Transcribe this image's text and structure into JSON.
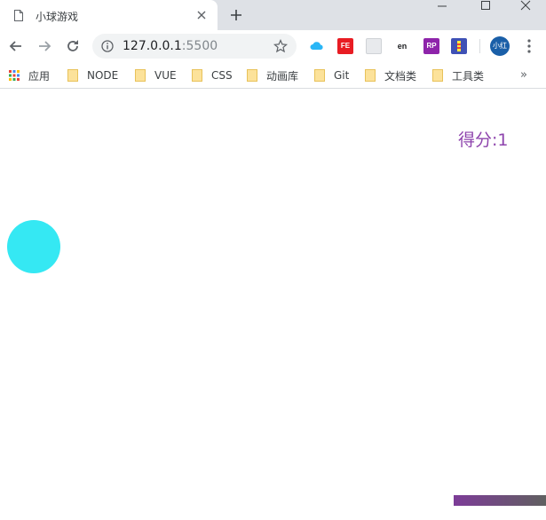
{
  "browser": {
    "tab": {
      "title": "小球游戏"
    },
    "toolbar": {
      "url_host": "127.0.0.1",
      "url_port": ":5500",
      "extensions": {
        "fe": "FE",
        "en": "en",
        "rp": "RP"
      },
      "profile": "小红"
    },
    "bookmarks": [
      {
        "label": "应用",
        "icon": "apps-grid-icon"
      },
      {
        "label": "NODE",
        "icon": "folder-icon"
      },
      {
        "label": "VUE",
        "icon": "folder-icon"
      },
      {
        "label": "CSS",
        "icon": "folder-icon"
      },
      {
        "label": "动画库",
        "icon": "folder-icon"
      },
      {
        "label": "Git",
        "icon": "folder-icon"
      },
      {
        "label": "文档类",
        "icon": "folder-icon"
      },
      {
        "label": "工具类",
        "icon": "folder-icon"
      }
    ],
    "more_glyph": "»"
  },
  "game": {
    "score_label": "得分:",
    "score": "1",
    "colors": {
      "score_text": "#8e44ad",
      "ball": "#35e8f3",
      "paddle_start": "#7d3c98",
      "paddle_end": "#606060"
    }
  }
}
